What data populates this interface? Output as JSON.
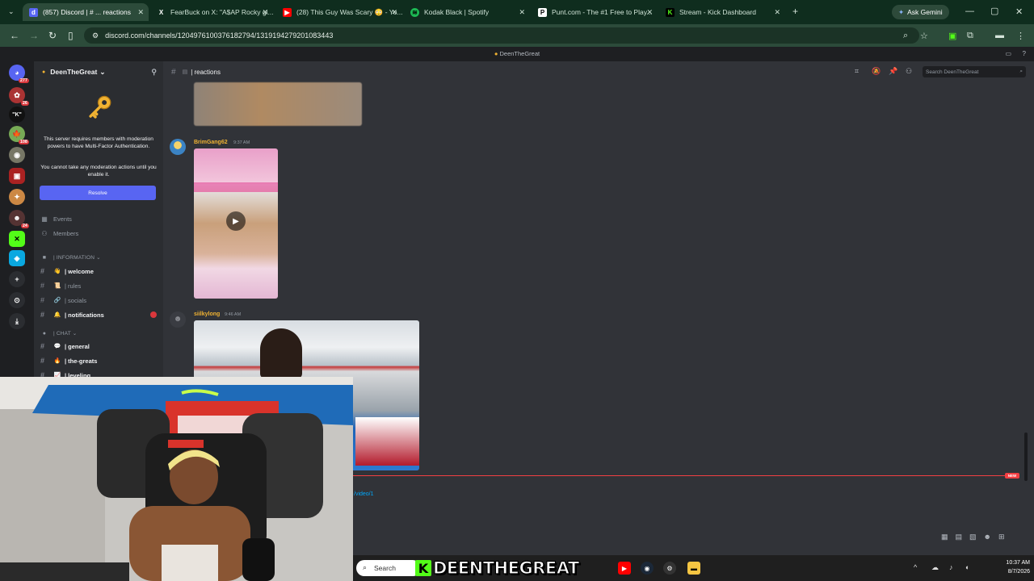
{
  "browser": {
    "tabs": [
      {
        "title": "(857) Discord | # ... reactions",
        "icon": "discord-icon",
        "color": "#5865f2"
      },
      {
        "title": "FearBuck on X: \"A$AP Rocky gi...",
        "icon": "x-icon",
        "color": "#000000"
      },
      {
        "title": "(28) This Guy Was Scary 😳 - Yo...",
        "icon": "youtube-icon",
        "color": "#ff0000"
      },
      {
        "title": "Kodak Black | Spotify",
        "icon": "spotify-icon",
        "color": "#1db954"
      },
      {
        "title": "Punt.com - The #1 Free to Play...",
        "icon": "punt-icon",
        "color": "#ffffff"
      },
      {
        "title": "Stream - Kick Dashboard",
        "icon": "kick-icon",
        "color": "#53fc18"
      }
    ],
    "new_tab": "+",
    "gemini_label": "Ask Gemini",
    "url": "discord.com/channels/1204976100376182794/1319194279201083443",
    "window_title": "DeenTheGreat"
  },
  "discord": {
    "server_name": "DeenTheGreat",
    "guild_badges": [
      "277",
      "26",
      "108",
      "24"
    ],
    "mfa": {
      "message": "This server requires members with moderation powers to have Multi-Factor Authentication.",
      "sub": "You cannot take any moderation actions until you enable it.",
      "button": "Resolve"
    },
    "nav": {
      "events": "Events",
      "members": "Members"
    },
    "categories": {
      "information": "| INFORMATION ⌄",
      "chat": "| CHAT ⌄"
    },
    "channels": [
      {
        "name": "| welcome",
        "emoji": "👋",
        "bold": true
      },
      {
        "name": "| rules",
        "emoji": "📜",
        "bold": false
      },
      {
        "name": "| socials",
        "emoji": "🔗",
        "bold": false
      },
      {
        "name": "| notifications",
        "emoji": "🔔",
        "bold": true
      }
    ],
    "chat_channels": [
      {
        "name": "| general",
        "emoji": "💬",
        "bold": true
      },
      {
        "name": "| the-greats",
        "emoji": "🔥",
        "bold": true
      },
      {
        "name": "| leveling",
        "emoji": "📈",
        "bold": true
      }
    ],
    "current_channel": "| reactions",
    "search_placeholder": "Search DeenTheGreat",
    "messages": [
      {
        "author": "BrimGang62",
        "time": "9:37 AM",
        "color": "#f0b232"
      },
      {
        "author": "siilkylong",
        "time": "9:46 AM",
        "color": "#f0b232"
      }
    ],
    "new_label": "NEW",
    "link_fragment": "/video/1"
  },
  "taskbar": {
    "search_placeholder": "Search",
    "brand_k": "K",
    "brand_text": "DEENTHEGREAT",
    "time": "10:37 AM",
    "date": "8/7/2026"
  }
}
